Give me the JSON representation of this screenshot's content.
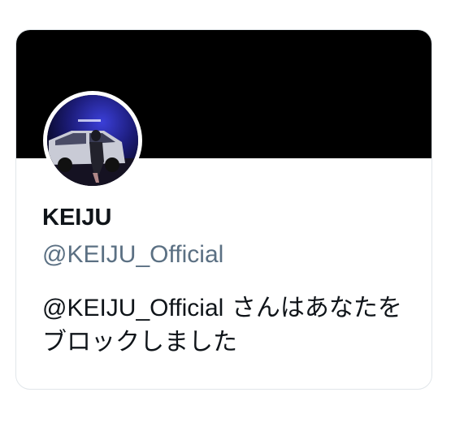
{
  "profile": {
    "display_name": "KEIJU",
    "handle": "@KEIJU_Official",
    "avatar_icon": "profile-photo-night-car",
    "banner_color": "#000000"
  },
  "blocked_notice": {
    "mention": "@KEIJU_Official",
    "message": " さんはあなたをブロックしました"
  },
  "colors": {
    "primary_text": "#0f1419",
    "secondary_text": "#5b7083",
    "card_border": "#e1e6ea"
  }
}
